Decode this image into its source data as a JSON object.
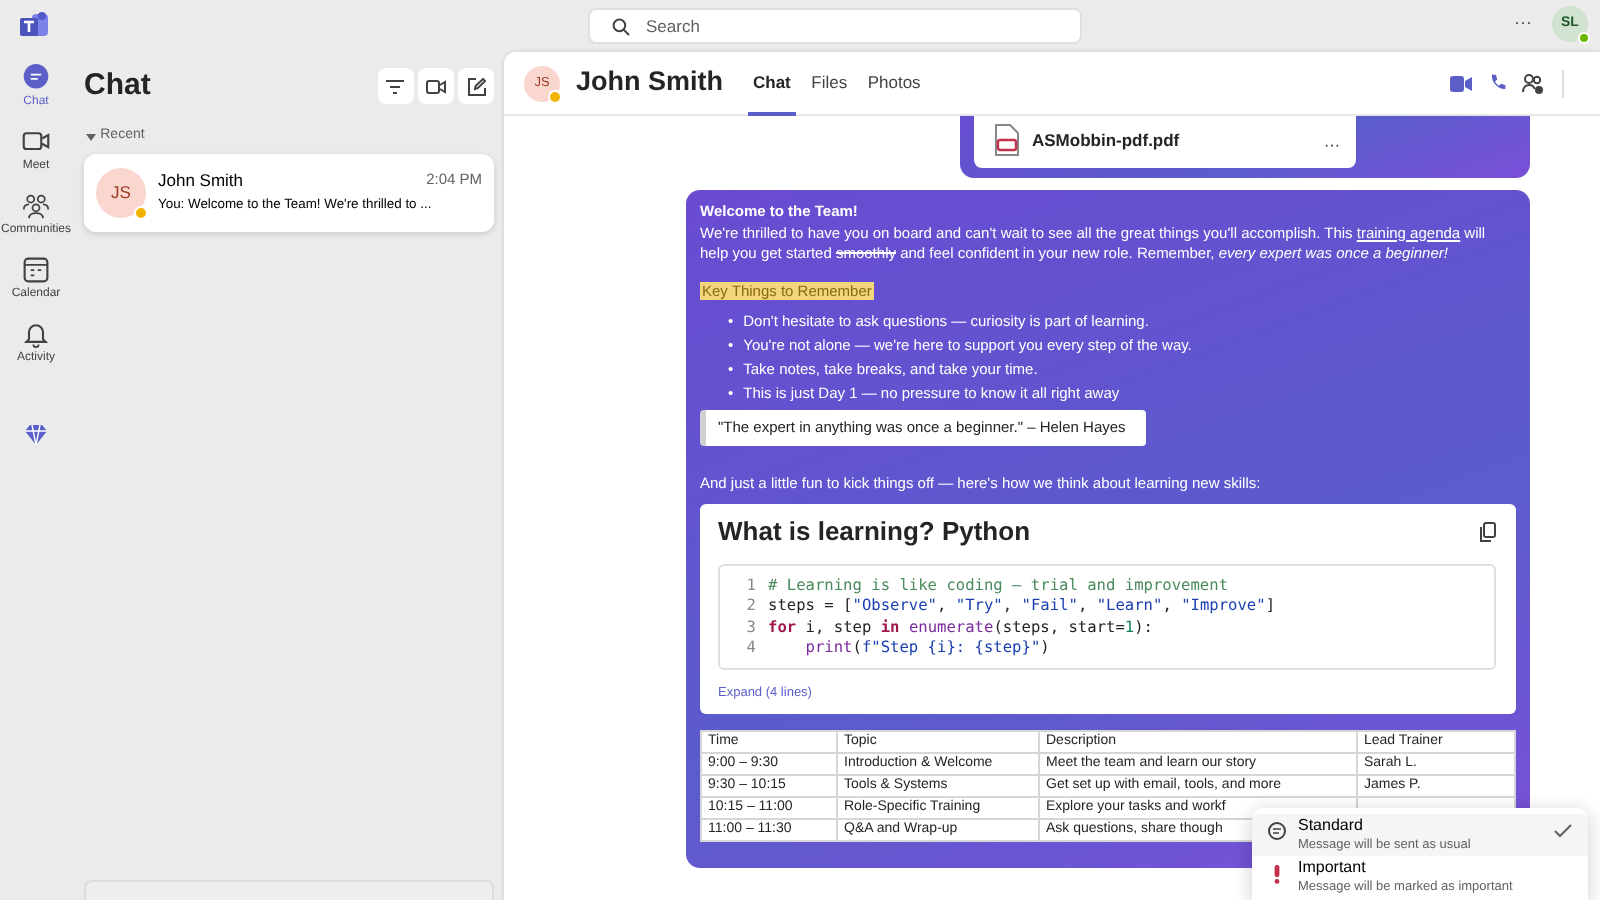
{
  "top_bar": {
    "search": {
      "placeholder": "Search"
    },
    "more": "···",
    "user_avatar": {
      "initials": "SL"
    }
  },
  "nav_rail": [
    {
      "label": "Chat",
      "kind": "chat",
      "selected": true
    },
    {
      "label": "Meet",
      "kind": "meet",
      "selected": false
    },
    {
      "label": "Communities",
      "kind": "communities",
      "selected": false
    },
    {
      "label": "Calendar",
      "kind": "calendar",
      "selected": false
    },
    {
      "label": "Activity",
      "kind": "activity",
      "selected": false
    }
  ],
  "chat_list": {
    "title": "Chat",
    "section": {
      "label": "Recent",
      "expanded": true
    },
    "items": [
      {
        "initials": "JS",
        "name": "John Smith",
        "time": "2:04 PM",
        "preview": "You: Welcome to the Team! We're thrilled to ...",
        "selected": true
      }
    ]
  },
  "conversation": {
    "contact": {
      "initials": "JS",
      "name": "John Smith"
    },
    "tabs": [
      {
        "label": "Chat",
        "selected": true
      },
      {
        "label": "Files",
        "selected": false
      },
      {
        "label": "Photos",
        "selected": false
      }
    ],
    "attachment": {
      "file_name": "ASMobbin-pdf.pdf",
      "more": "···"
    },
    "message": {
      "title": "Welcome to the Team!",
      "paragraph": [
        {
          "kind": "plain",
          "text": "We're thrilled to have you on board and can't wait to see all the great things you'll accomplish. This "
        },
        {
          "kind": "link",
          "text": "training agenda"
        },
        {
          "kind": "plain",
          "text": " will help you get started "
        },
        {
          "kind": "strike",
          "text": "smoothly"
        },
        {
          "kind": "plain",
          "text": " and feel confident in your new role. Remember, "
        },
        {
          "kind": "italic",
          "text": "every expert was once a beginner!"
        }
      ],
      "highlight": "Key Things to Remember",
      "bullets": [
        {
          "marker": "•",
          "text": "Don't hesitate to ask questions — curiosity is part of learning."
        },
        {
          "marker": "•",
          "text": "You're not alone — we're here to support you every step of the way."
        },
        {
          "marker": "•",
          "text": "Take notes, take breaks, and take your time."
        },
        {
          "marker": "•",
          "text": "This is just Day 1 — no pressure to know it all right away"
        }
      ],
      "quote": "\"The expert in anything was once a beginner.\" – Helen Hayes",
      "intro": "And just a little fun to kick things off — here's how we think about learning new skills:",
      "code_card": {
        "title": "What is learning? Python",
        "expand": "Expand (4 lines)",
        "lines": [
          {
            "number": "1",
            "tokens": [
              {
                "kind": "comment",
                "text": "# Learning is like coding – trial and improvement"
              }
            ]
          },
          {
            "number": "2",
            "tokens": [
              {
                "kind": "plain",
                "text": "steps = ["
              },
              {
                "kind": "string",
                "text": "\"Observe\""
              },
              {
                "kind": "plain",
                "text": ", "
              },
              {
                "kind": "string",
                "text": "\"Try\""
              },
              {
                "kind": "plain",
                "text": ", "
              },
              {
                "kind": "string",
                "text": "\"Fail\""
              },
              {
                "kind": "plain",
                "text": ", "
              },
              {
                "kind": "string",
                "text": "\"Learn\""
              },
              {
                "kind": "plain",
                "text": ", "
              },
              {
                "kind": "string",
                "text": "\"Improve\""
              },
              {
                "kind": "plain",
                "text": "]"
              }
            ]
          },
          {
            "number": "3",
            "tokens": [
              {
                "kind": "keyword",
                "text": "for"
              },
              {
                "kind": "plain",
                "text": " i, step "
              },
              {
                "kind": "keyword",
                "text": "in "
              },
              {
                "kind": "builtin",
                "text": "enumerate"
              },
              {
                "kind": "plain",
                "text": "(steps, start="
              },
              {
                "kind": "number",
                "text": "1"
              },
              {
                "kind": "plain",
                "text": "):"
              }
            ]
          },
          {
            "number": "4",
            "tokens": [
              {
                "kind": "builtin",
                "text": "    print"
              },
              {
                "kind": "plain",
                "text": "("
              },
              {
                "kind": "string",
                "text": "f\"Step {i}: {step}\""
              },
              {
                "kind": "plain",
                "text": ")"
              }
            ]
          }
        ]
      },
      "table": {
        "columns": [
          "Time",
          "Topic",
          "Description",
          "Lead Trainer"
        ],
        "rows": [
          [
            "9:00 – 9:30",
            "Introduction & Welcome",
            "Meet the team and learn our story",
            "Sarah L."
          ],
          [
            "9:30 – 10:15",
            "Tools & Systems",
            "Get set up with email, tools, and more",
            "James P."
          ],
          [
            "10:15 – 11:00",
            "Role-Specific Training",
            "Explore your tasks and workf"
          ],
          [
            "11:00 – 11:30",
            "Q&A and Wrap-up",
            "Ask questions, share though"
          ]
        ]
      }
    },
    "priority_menu": [
      {
        "kind": "standard",
        "title": "Standard",
        "subtitle": "Message will be sent as usual",
        "selected": true
      },
      {
        "kind": "important",
        "title": "Important",
        "subtitle": "Message will be marked as important",
        "selected": false
      }
    ]
  }
}
